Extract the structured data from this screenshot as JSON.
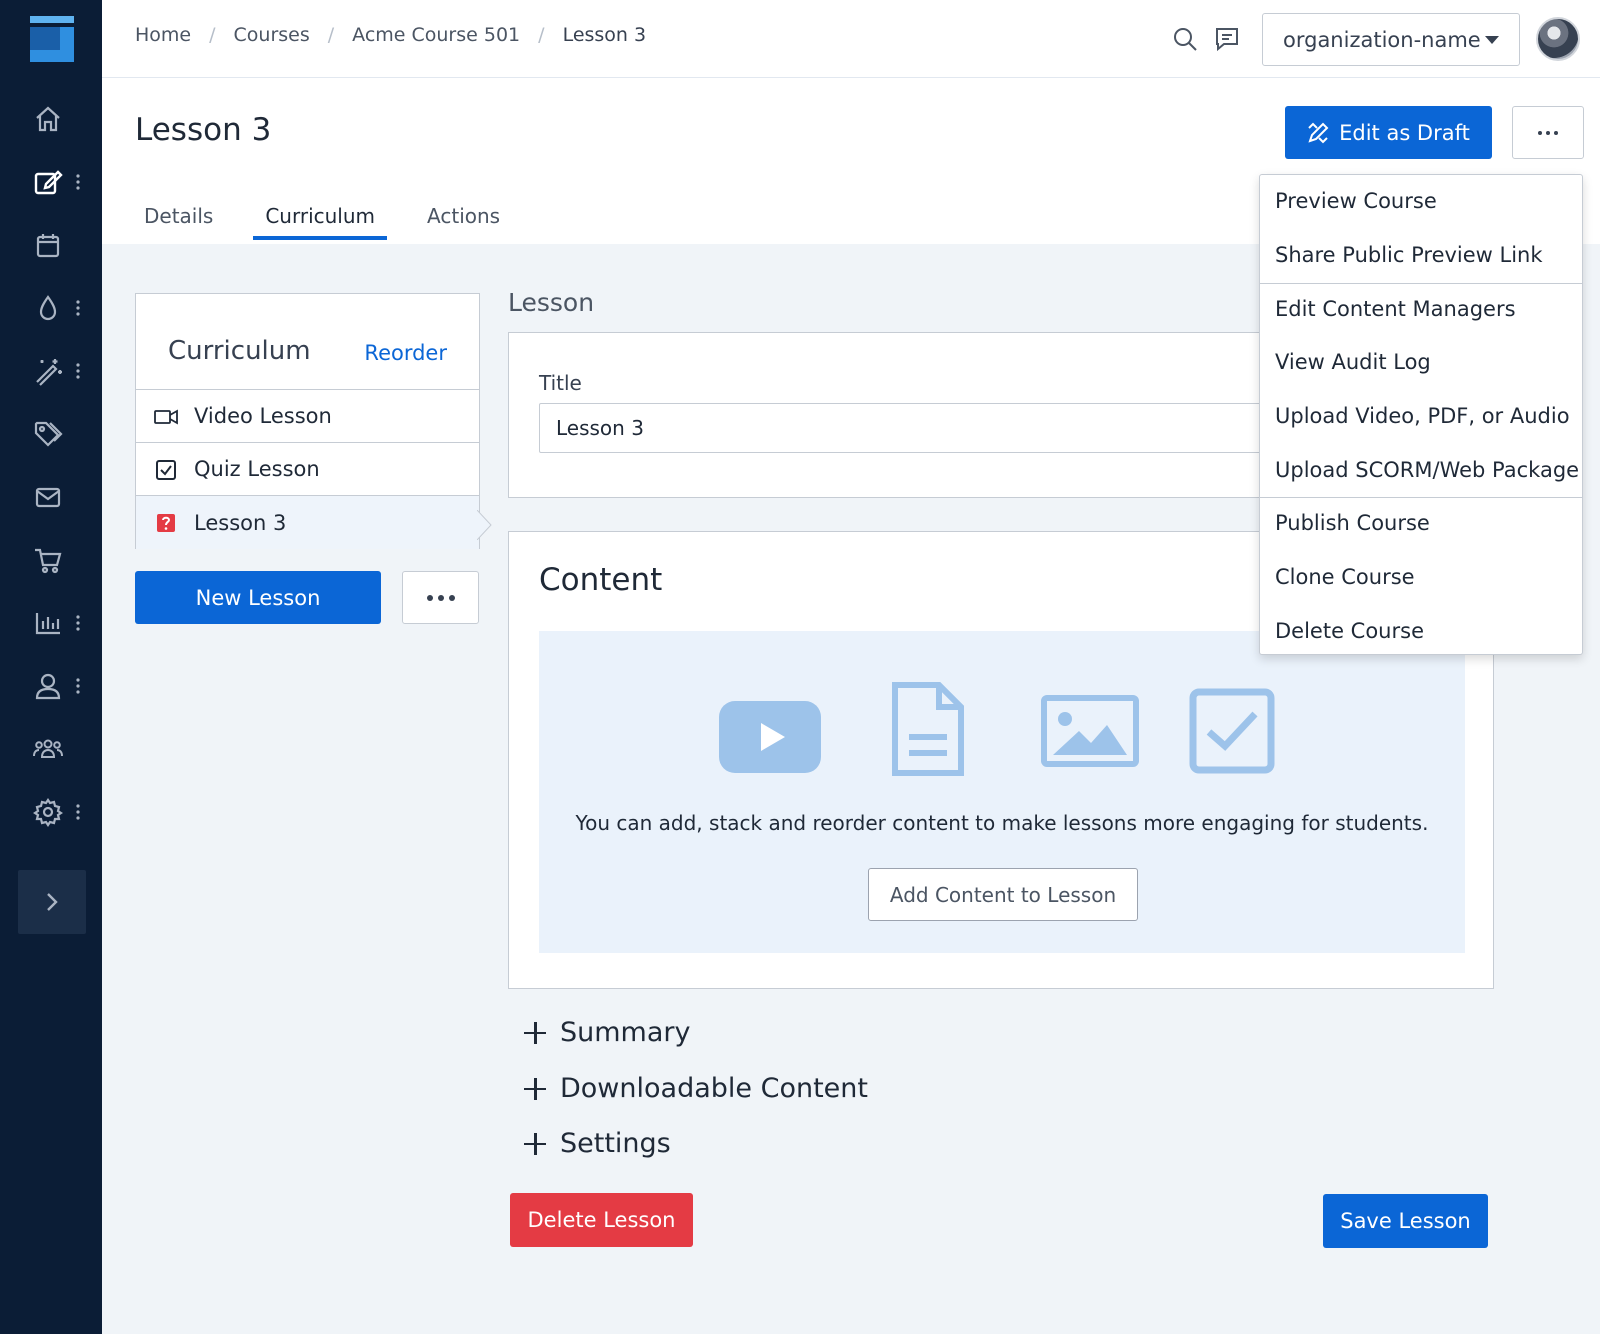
{
  "breadcrumb": {
    "items": [
      "Home",
      "Courses",
      "Acme Course 501"
    ],
    "current": "Lesson 3"
  },
  "org_select": {
    "value": "organization-name"
  },
  "page": {
    "title": "Lesson 3",
    "edit_button": "Edit as Draft"
  },
  "tabs": [
    "Details",
    "Curriculum",
    "Actions"
  ],
  "active_tab": "Curriculum",
  "curriculum": {
    "title": "Curriculum",
    "reorder": "Reorder",
    "items": [
      {
        "label": "Video Lesson",
        "icon": "video-camera-icon"
      },
      {
        "label": "Quiz Lesson",
        "icon": "checkbox-icon"
      },
      {
        "label": "Lesson 3",
        "icon": "question-icon"
      }
    ],
    "active_index": 2,
    "new_lesson": "New Lesson"
  },
  "lesson": {
    "section_label": "Lesson",
    "title_label": "Title",
    "title_value": "Lesson 3"
  },
  "content": {
    "title": "Content",
    "description": "You can add, stack and reorder content to make lessons more engaging for students.",
    "add_button": "Add Content to Lesson",
    "icons": [
      "video-play-icon",
      "document-icon",
      "image-icon",
      "checkbox-icon"
    ]
  },
  "accordions": [
    "Summary",
    "Downloadable Content",
    "Settings"
  ],
  "actions": {
    "delete": "Delete Lesson",
    "save": "Save Lesson"
  },
  "dropdown": {
    "items": [
      "Preview Course",
      "Share Public Preview Link",
      "Edit Content Managers",
      "View Audit Log",
      "Upload Video, PDF, or Audio",
      "Upload SCORM/Web Package",
      "Publish Course",
      "Clone Course",
      "Delete Course"
    ]
  },
  "colors": {
    "sidebar": "#0b1d36",
    "primary": "#0b66d6",
    "danger": "#e43b44",
    "content_bg": "#eaf2fb",
    "icon_tint": "#9dc3ea"
  }
}
